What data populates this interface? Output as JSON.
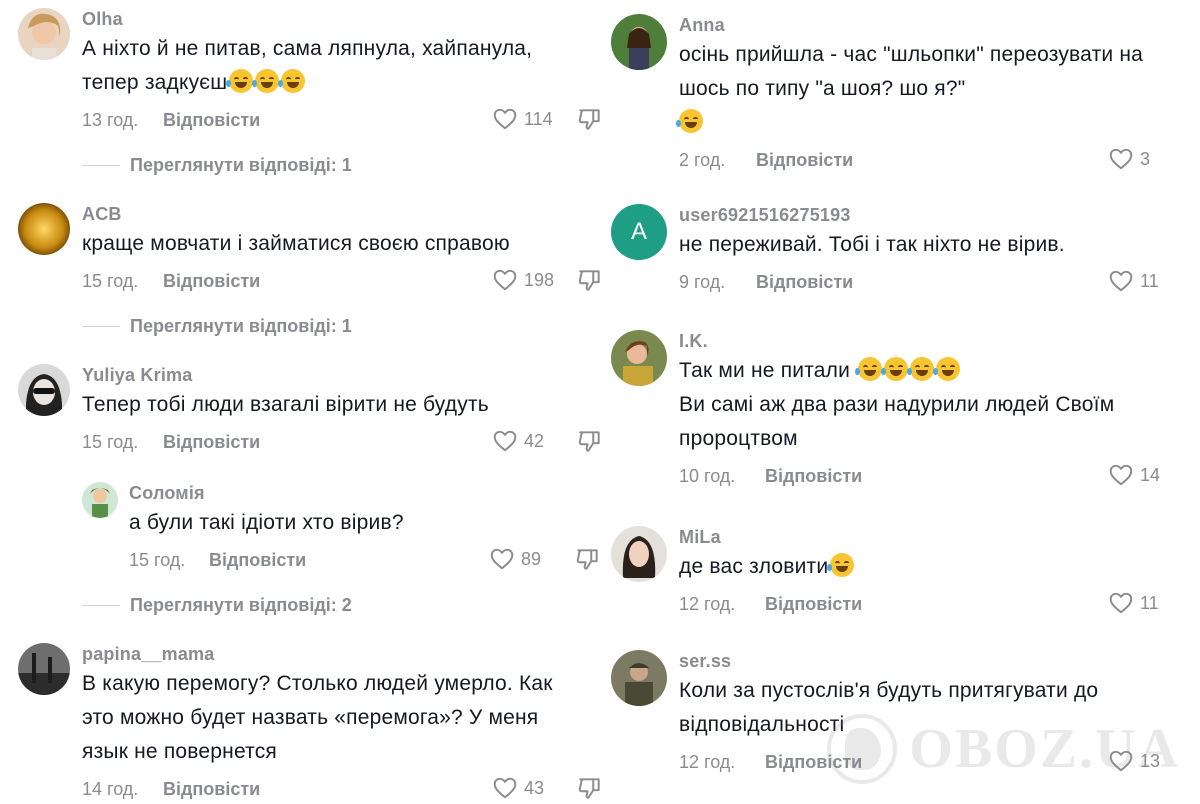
{
  "labels": {
    "reply": "Відповісти"
  },
  "icons": {
    "like": "heart-outline-icon",
    "dislike": "thumbs-down-icon",
    "emoji_rofl": "rolling-on-floor-laughing-emoji",
    "emoji_joy": "face-with-tears-of-joy-emoji"
  },
  "colors": {
    "text": "#161823",
    "muted": "#8a8b91",
    "avatar_a": "#1e9e85"
  },
  "left": {
    "c1": {
      "user": "Olha",
      "text1": "А ніхто й не питав, сама ляпнула, хайпанула,",
      "text2": "тепер задкуєш",
      "time": "13 год.",
      "likes": "114",
      "replies": "Переглянути відповіді: 1"
    },
    "c2": {
      "user": "ACB",
      "text1": "краще мовчати і займатися своєю справою",
      "time": "15 год.",
      "likes": "198",
      "replies": "Переглянути відповіді: 1"
    },
    "c3": {
      "user": "Yuliya Krima",
      "text1": "Тепер тобі люди взагалі вірити не будуть",
      "time": "15 год.",
      "likes": "42"
    },
    "c3r": {
      "user": "Соломія",
      "text1": "а були такі ідіоти хто вірив?",
      "time": "15 год.",
      "likes": "89",
      "replies": "Переглянути відповіді: 2"
    },
    "c4": {
      "user": "papina__mama",
      "text1": "В какую перемогу? Столько людей умерло. Как",
      "text2": "это можно будет назвать «перемога»? У меня",
      "text3": "язык не повернется",
      "time": "14 год.",
      "likes": "43"
    }
  },
  "right": {
    "c1": {
      "user": "Anna",
      "text1": "осінь прийшла - час \"шльопки\" переозувати на",
      "text2": "шось по типу \"а шоя? шо я?\"",
      "time": "2 год.",
      "likes": "3"
    },
    "c2": {
      "user": "user6921516275193",
      "avatar_letter": "A",
      "text1": "не переживай. Тобі і так ніхто не вірив.",
      "time": "9 год.",
      "likes": "11"
    },
    "c3": {
      "user": "I.K.",
      "text1": "Так ми не питали",
      "text2": "Ви самі аж два рази надурили людей Своїм",
      "text3": "пророцтвом",
      "time": "10 год.",
      "likes": "14"
    },
    "c4": {
      "user": "MiLa",
      "text1": "де вас зловити",
      "time": "12 год.",
      "likes": "11"
    },
    "c5": {
      "user": "ser.ss",
      "text1": "Коли за пустослів'я будуть притягувати до",
      "text2": "відповідальності",
      "time": "12 год.",
      "likes": "13"
    }
  },
  "watermark": {
    "text": "OBOZ.UA"
  }
}
